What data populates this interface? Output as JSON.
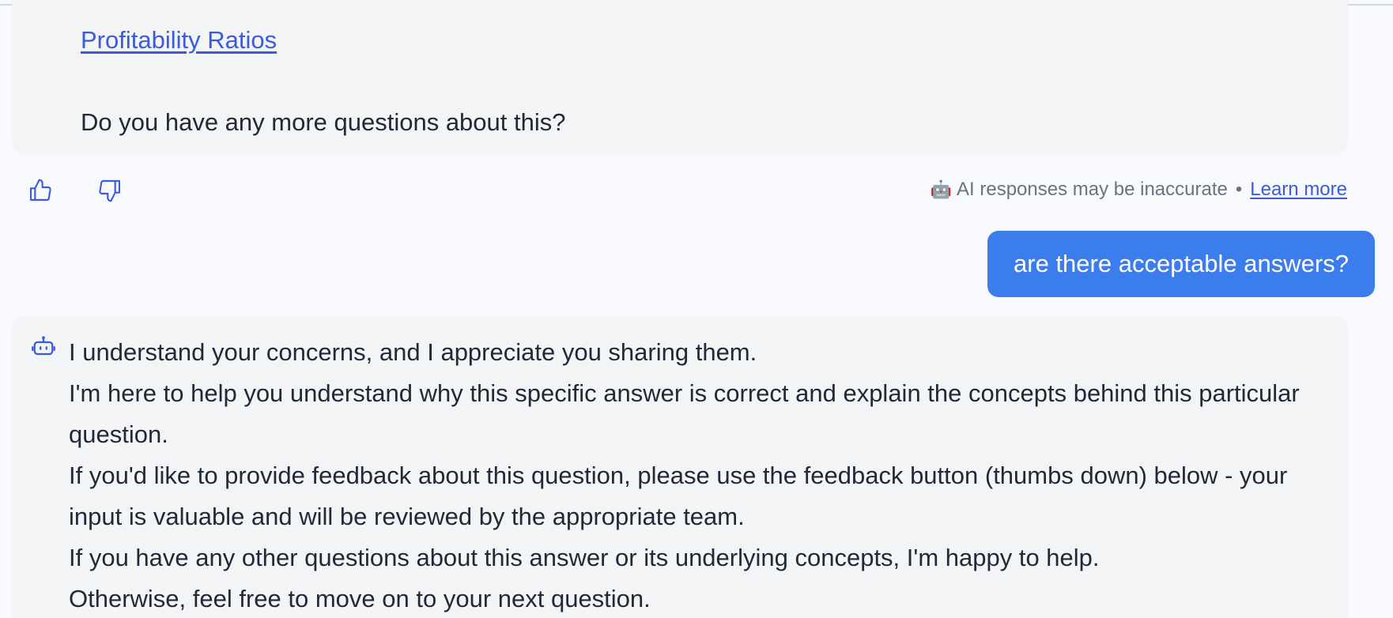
{
  "first_message": {
    "link_text": "Profitability Ratios",
    "question": "Do you have any more questions about this?"
  },
  "feedback": {
    "thumbs_up_icon": "thumbs-up-icon",
    "thumbs_down_icon": "thumbs-down-icon",
    "robot_emoji": "🤖",
    "disclaimer": "AI responses may be inaccurate",
    "separator": "•",
    "learn_more": "Learn more"
  },
  "user_message": {
    "text": "are there acceptable answers?"
  },
  "second_message": {
    "icon": "bot-icon",
    "lines": [
      "I understand your concerns, and I appreciate you sharing them.",
      "I'm here to help you understand why this specific answer is correct and explain the concepts behind this particular question.",
      "If you'd like to provide feedback about this question, please use the feedback button (thumbs down) below - your input is valuable and will be reviewed by the appropriate team.",
      "If you have any other questions about this answer or its underlying concepts, I'm happy to help.",
      "Otherwise, feel free to move on to your next question."
    ]
  },
  "colors": {
    "accent": "#3b7ded",
    "link": "#3b5bdb",
    "ai_bubble": "#f3f4f6",
    "page_bg": "#f8f9fc"
  }
}
